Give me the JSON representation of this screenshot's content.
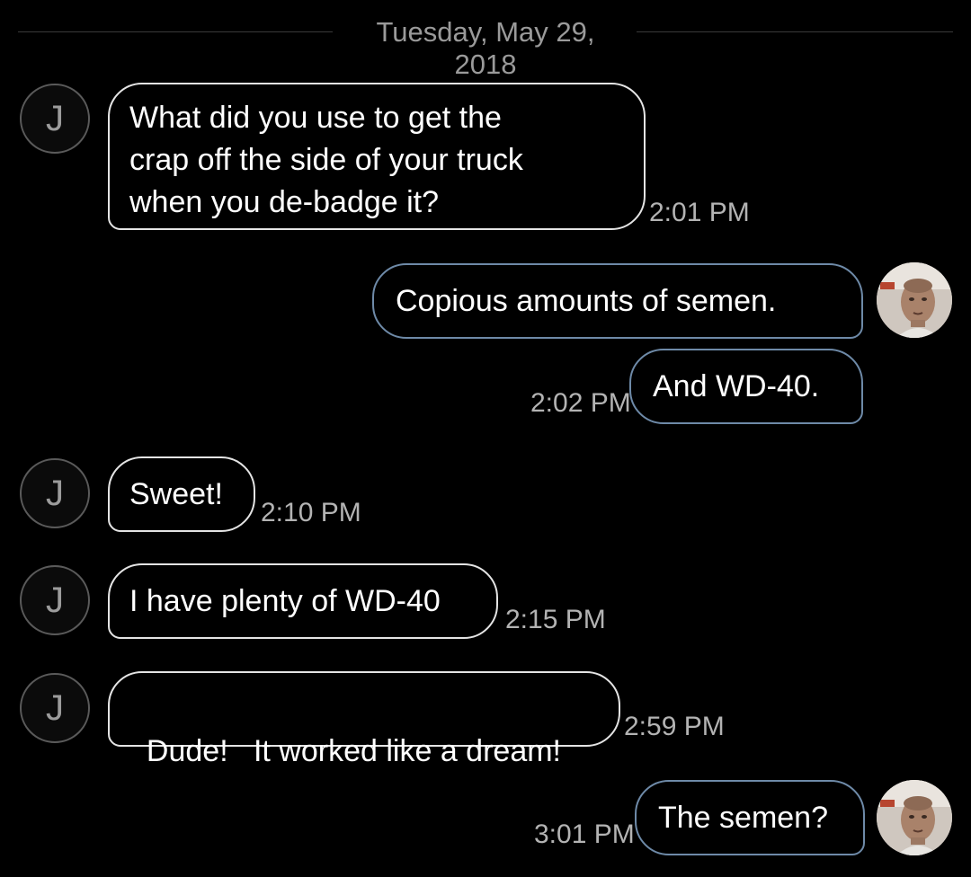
{
  "date_header": "Tuesday, May 29, 2018",
  "contact": {
    "initial": "J"
  },
  "messages": [
    {
      "direction": "incoming",
      "lines": [
        "What did you use to get the",
        "crap off the side of your truck",
        "when you de-badge it?"
      ],
      "time": "2:01 PM"
    },
    {
      "direction": "outgoing",
      "text": "Copious amounts of semen."
    },
    {
      "direction": "outgoing",
      "text": "And WD-40.",
      "time": "2:02 PM"
    },
    {
      "direction": "incoming",
      "text": "Sweet!",
      "time": "2:10 PM"
    },
    {
      "direction": "incoming",
      "text": "I have plenty of WD-40",
      "time": "2:15 PM"
    },
    {
      "direction": "incoming",
      "text": "Dude!   It worked like a dream!",
      "time": "2:59 PM"
    },
    {
      "direction": "outgoing",
      "text": "The semen?",
      "time": "3:01 PM"
    }
  ],
  "colors": {
    "background": "#000000",
    "incoming_border": "#e4e4e4",
    "outgoing_border": "#6e8aa8",
    "timestamp": "#b3b3b3",
    "date_text": "#9a9a9a"
  },
  "icons": {
    "contact_avatar": "letter-avatar-icon",
    "self_avatar": "profile-photo-avatar"
  }
}
